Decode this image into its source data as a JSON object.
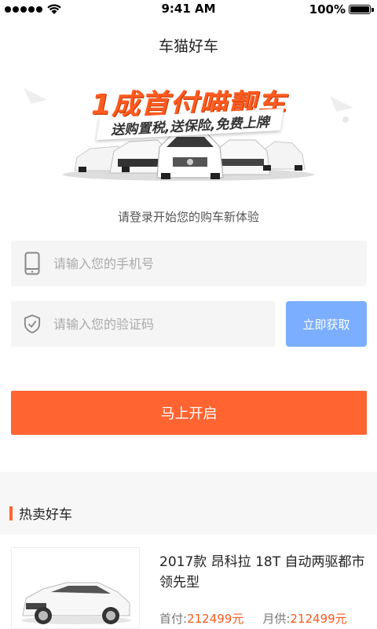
{
  "status_bar": {
    "carrier_dots": 5,
    "time": "9:41 AM",
    "battery": "100%",
    "battery_level": 1.0
  },
  "header": {
    "title": "车猫好车"
  },
  "banner": {
    "headline": "1成首付喵靓车",
    "subline": "送购置税,送保险,免费上牌"
  },
  "login": {
    "prompt": "请登录开始您的购车新体验",
    "phone_placeholder": "请输入您的手机号",
    "code_placeholder": "请输入您的验证码",
    "get_code_label": "立即获取",
    "submit_label": "马上开启"
  },
  "hot_section": {
    "title": "热卖好车",
    "items": [
      {
        "name": "2017款 昂科拉 18T 自动两驱都市领先型",
        "down_payment_label": "首付:",
        "down_payment_value": "212499元",
        "monthly_label": "月供:",
        "monthly_value": "212499元"
      }
    ]
  },
  "colors": {
    "accent": "#ff6431",
    "button_blue": "#7baeff",
    "field_bg": "#f5f5f5"
  },
  "icons": [
    "signal-dots-icon",
    "wifi-icon",
    "battery-icon",
    "phone-icon",
    "shield-check-icon"
  ]
}
